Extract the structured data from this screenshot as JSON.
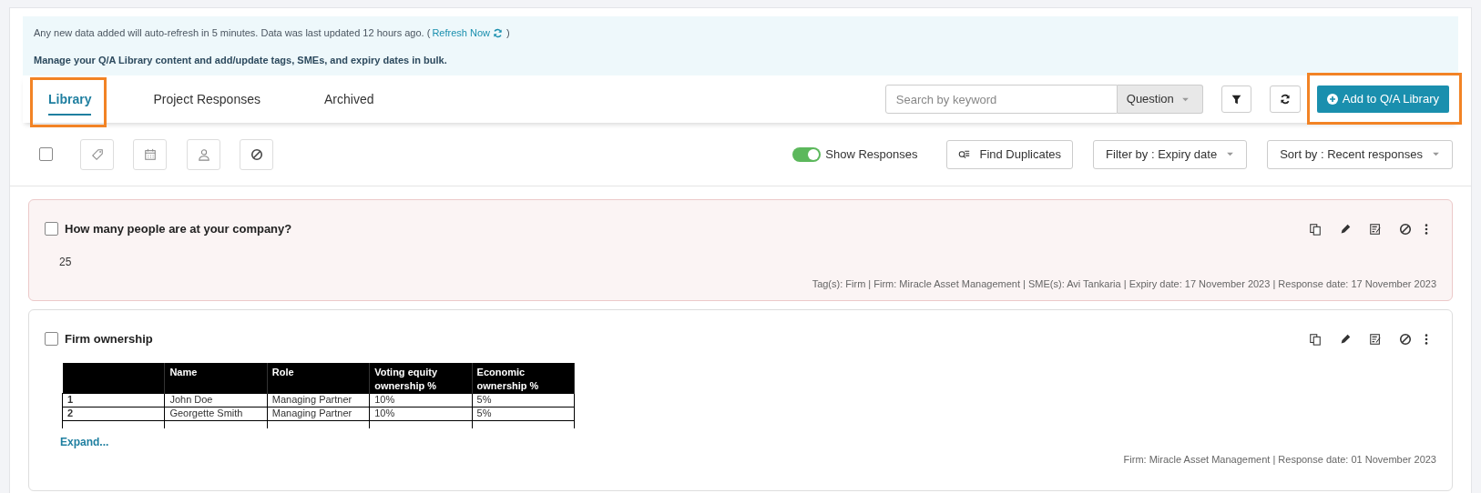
{
  "banner": {
    "notice": "Any new data added will auto-refresh in 5 minutes. Data was last updated 12 hours ago. (",
    "refresh_link": "Refresh Now",
    "notice_end": ")",
    "instruction": "Manage your Q/A Library content and add/update tags, SMEs, and expiry dates in bulk."
  },
  "tabs": [
    {
      "label": "Library",
      "selected": true,
      "highlighted": true
    },
    {
      "label": "Project Responses",
      "selected": false,
      "highlighted": false
    },
    {
      "label": "Archived",
      "selected": false,
      "highlighted": false
    }
  ],
  "search": {
    "placeholder": "Search by keyword",
    "scope": "Question"
  },
  "add_button": {
    "label": "Add to Q/A Library",
    "highlighted": true
  },
  "toolbar": {
    "select_all_checked": false,
    "show_responses": {
      "label": "Show Responses",
      "on": true
    },
    "find_duplicates": "Find Duplicates",
    "filter": "Filter by : Expiry date",
    "sort": "Sort by : Recent responses"
  },
  "cards": [
    {
      "question": "How many people are at your company?",
      "checked": false,
      "flagged": true,
      "kind": "text",
      "answer": "25",
      "meta": "Tag(s):  Firm | Firm: Miracle Asset Management | SME(s):  Avi Tankaria | Expiry date: 17 November 2023 | Response date: 17 November 2023"
    },
    {
      "question": "Firm ownership",
      "checked": false,
      "flagged": false,
      "kind": "table",
      "table": {
        "columns": [
          "",
          "Name",
          "Role",
          "Voting equity ownership %",
          "Economic ownership %"
        ],
        "rows": [
          [
            "1",
            "John Doe",
            "Managing Partner",
            "10%",
            "5%"
          ],
          [
            "2",
            "Georgette Smith",
            "Managing Partner",
            "10%",
            "5%"
          ]
        ]
      },
      "expand": "Expand...",
      "meta": "Firm: Miracle Asset Management | Response date: 01 November 2023"
    }
  ]
}
